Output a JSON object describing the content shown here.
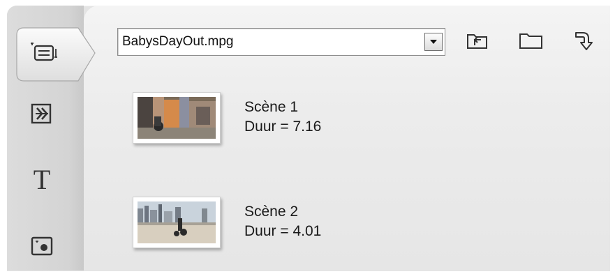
{
  "file_selector": {
    "value": "BabysDayOut.mpg"
  },
  "toolbar": {
    "icons": [
      "folder-up-icon",
      "folder-icon",
      "undo-arrow-icon"
    ]
  },
  "sidebar": {
    "tabs": [
      {
        "icon": "scene-clip-icon",
        "active": true
      },
      {
        "icon": "transition-icon",
        "active": false
      },
      {
        "icon": "title-text-icon",
        "label": "T",
        "active": false
      },
      {
        "icon": "photo-icon",
        "active": false
      }
    ]
  },
  "scenes": [
    {
      "title": "Scène 1",
      "duration": "Duur = 7.16"
    },
    {
      "title": "Scène 2",
      "duration": "Duur = 4.01"
    }
  ],
  "colors": {
    "panel_background": "#e8e8e8",
    "sidebar_background": "#d6d6d6",
    "text": "#1a1a1a"
  }
}
